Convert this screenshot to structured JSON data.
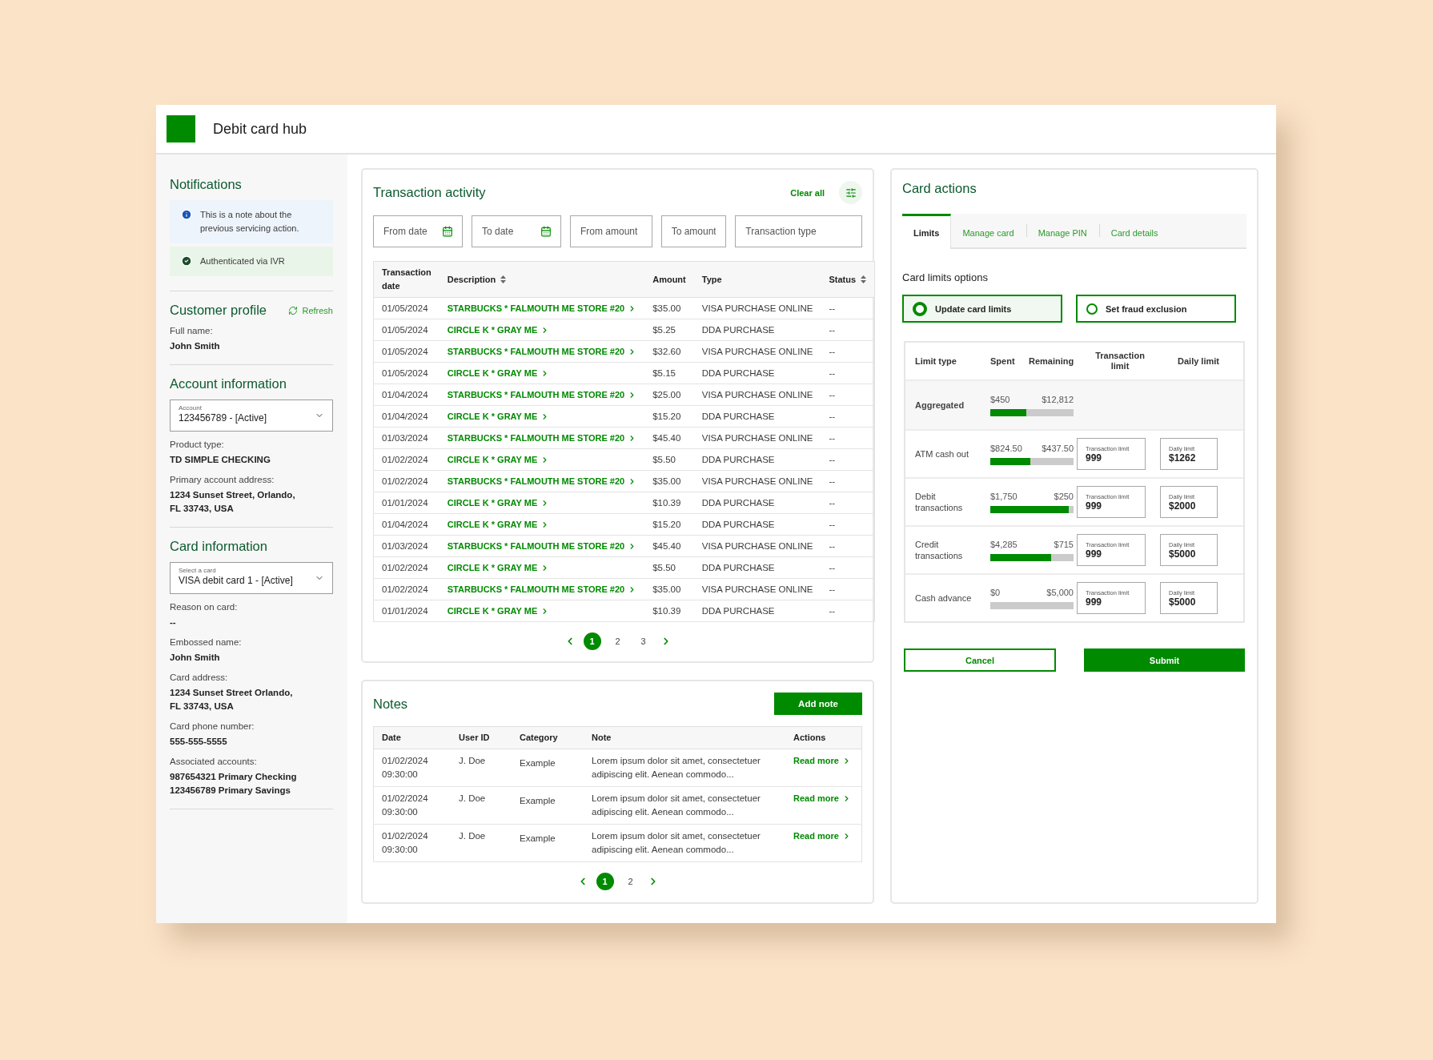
{
  "header": {
    "title": "Debit card hub"
  },
  "sidebar": [
    {
      "title": "Notifications",
      "notices": [
        {
          "kind": "info",
          "text": "This is a note about the previous servicing action."
        },
        {
          "kind": "success",
          "text": "Authenticated via IVR"
        }
      ]
    },
    {
      "title": "Customer profile",
      "action": "Refresh",
      "fields": [
        {
          "label": "Full name:",
          "lines": [
            "John Smith"
          ]
        }
      ]
    },
    {
      "title": "Account information",
      "select": {
        "label": "Account",
        "value": "123456789 - [Active]"
      },
      "fields": [
        {
          "label": "Product type:",
          "lines": [
            "TD SIMPLE CHECKING"
          ]
        },
        {
          "label": "Primary account address:",
          "lines": [
            "1234 Sunset Street, Orlando,",
            "FL 33743, USA"
          ]
        }
      ]
    },
    {
      "title": "Card information",
      "select": {
        "label": "Select a card",
        "value": "VISA debit card 1 - [Active]"
      },
      "fields": [
        {
          "label": "Reason on card:",
          "lines": [
            "--"
          ]
        },
        {
          "label": "Embossed name:",
          "lines": [
            "John Smith"
          ]
        },
        {
          "label": "Card address:",
          "lines": [
            "1234 Sunset Street Orlando,",
            "FL 33743, USA"
          ]
        },
        {
          "label": "Card phone number:",
          "lines": [
            "555-555-5555"
          ]
        },
        {
          "label": "Associated accounts:",
          "lines": [
            "987654321 Primary Checking",
            "123456789 Primary Savings"
          ]
        }
      ]
    }
  ],
  "transactions": {
    "title": "Transaction activity",
    "clear_all": "Clear all",
    "filters": [
      {
        "kind": "date",
        "placeholder": "From date"
      },
      {
        "kind": "date",
        "placeholder": "To date"
      },
      {
        "kind": "text",
        "placeholder": "From amount"
      },
      {
        "kind": "text",
        "placeholder": "To amount"
      },
      {
        "kind": "text",
        "placeholder": "Transaction type"
      }
    ],
    "columns": [
      {
        "label": "Transaction date",
        "sortable": false
      },
      {
        "label": "Description",
        "sortable": true
      },
      {
        "label": "Amount",
        "sortable": false
      },
      {
        "label": "Type",
        "sortable": false
      },
      {
        "label": "Status",
        "sortable": true
      }
    ],
    "rows": [
      [
        "01/05/2024",
        "STARBUCKS * FALMOUTH ME STORE #20",
        "$35.00",
        "VISA PURCHASE ONLINE",
        "--"
      ],
      [
        "01/05/2024",
        "CIRCLE K * GRAY ME",
        "$5.25",
        "DDA PURCHASE",
        "--"
      ],
      [
        "01/05/2024",
        "STARBUCKS * FALMOUTH ME STORE #20",
        "$32.60",
        "VISA PURCHASE ONLINE",
        "--"
      ],
      [
        "01/05/2024",
        "CIRCLE K * GRAY ME",
        "$5.15",
        "DDA PURCHASE",
        "--"
      ],
      [
        "01/04/2024",
        "STARBUCKS * FALMOUTH ME STORE #20",
        "$25.00",
        "VISA PURCHASE ONLINE",
        "--"
      ],
      [
        "01/04/2024",
        "CIRCLE K * GRAY ME",
        "$15.20",
        "DDA PURCHASE",
        "--"
      ],
      [
        "01/03/2024",
        "STARBUCKS * FALMOUTH ME STORE #20",
        "$45.40",
        "VISA PURCHASE ONLINE",
        "--"
      ],
      [
        "01/02/2024",
        "CIRCLE K * GRAY ME",
        "$5.50",
        "DDA PURCHASE",
        "--"
      ],
      [
        "01/02/2024",
        "STARBUCKS * FALMOUTH ME STORE #20",
        "$35.00",
        "VISA PURCHASE ONLINE",
        "--"
      ],
      [
        "01/01/2024",
        "CIRCLE K * GRAY ME",
        "$10.39",
        "DDA PURCHASE",
        "--"
      ],
      [
        "01/04/2024",
        "CIRCLE K * GRAY ME",
        "$15.20",
        "DDA PURCHASE",
        "--"
      ],
      [
        "01/03/2024",
        "STARBUCKS * FALMOUTH ME STORE #20",
        "$45.40",
        "VISA PURCHASE ONLINE",
        "--"
      ],
      [
        "01/02/2024",
        "CIRCLE K * GRAY ME",
        "$5.50",
        "DDA PURCHASE",
        "--"
      ],
      [
        "01/02/2024",
        "STARBUCKS * FALMOUTH ME STORE #20",
        "$35.00",
        "VISA PURCHASE ONLINE",
        "--"
      ],
      [
        "01/01/2024",
        "CIRCLE K * GRAY ME",
        "$10.39",
        "DDA PURCHASE",
        "--"
      ]
    ],
    "pagination": [
      {
        "label": "1",
        "selected": true
      },
      {
        "label": "2",
        "selected": false
      },
      {
        "label": "3",
        "selected": false
      }
    ]
  },
  "notes": {
    "title": "Notes",
    "add_note": "Add note",
    "columns": [
      "Date",
      "User ID",
      "Category",
      "Note",
      "Actions"
    ],
    "rows": [
      {
        "date": "01/02/2024 09:30:00",
        "user": "J. Doe",
        "category": "Example",
        "note": "Lorem ipsum dolor sit amet, consectetuer adipiscing elit. Aenean commodo...",
        "action": "Read more"
      },
      {
        "date": "01/02/2024 09:30:00",
        "user": "J. Doe",
        "category": "Example",
        "note": "Lorem ipsum dolor sit amet, consectetuer adipiscing elit. Aenean commodo...",
        "action": "Read more"
      },
      {
        "date": "01/02/2024 09:30:00",
        "user": "J. Doe",
        "category": "Example",
        "note": "Lorem ipsum dolor sit amet, consectetuer adipiscing elit. Aenean commodo...",
        "action": "Read more"
      }
    ],
    "pagination": [
      {
        "label": "1",
        "selected": true
      },
      {
        "label": "2",
        "selected": false
      }
    ]
  },
  "card_actions": {
    "title": "Card actions",
    "tabs": [
      {
        "label": "Limits",
        "selected": true
      },
      {
        "label": "Manage card",
        "selected": false
      },
      {
        "label": "Manage PIN",
        "selected": false
      },
      {
        "label": "Card details",
        "selected": false
      }
    ],
    "options_title": "Card limits options",
    "options": [
      {
        "label": "Update card limits",
        "selected": true
      },
      {
        "label": "Set fraud exclusion",
        "selected": false
      }
    ],
    "columns": [
      "Limit type",
      "Spent",
      "Remaining",
      "Transaction limit",
      "Daily limit"
    ],
    "rows": [
      {
        "kind": "aggregate",
        "type": "Aggregated",
        "spent": "$450",
        "remaining": "$12,812",
        "level": 0.43
      },
      {
        "kind": "editable",
        "type": "ATM cash out",
        "spent": "$824.50",
        "remaining": "$437.50",
        "level": 0.48,
        "transaction_limit": {
          "label": "Transaction limit",
          "value": "999"
        },
        "daily_limit": {
          "label": "Daily limit",
          "value": "$1262"
        }
      },
      {
        "kind": "editable",
        "type": "Debit transactions",
        "spent": "$1,750",
        "remaining": "$250",
        "level": 0.94,
        "transaction_limit": {
          "label": "Transaction limit",
          "value": "999"
        },
        "daily_limit": {
          "label": "Daily limit",
          "value": "$2000"
        }
      },
      {
        "kind": "editable",
        "type": "Credit transactions",
        "spent": "$4,285",
        "remaining": "$715",
        "level": 0.73,
        "transaction_limit": {
          "label": "Transaction limit",
          "value": "999"
        },
        "daily_limit": {
          "label": "Daily limit",
          "value": "$5000"
        }
      },
      {
        "kind": "editable",
        "type": "Cash advance",
        "spent": "$0",
        "remaining": "$5,000",
        "level": 0,
        "transaction_limit": {
          "label": "Transaction limit",
          "value": "999"
        },
        "daily_limit": {
          "label": "Daily limit",
          "value": "$5000"
        }
      }
    ],
    "buttons": [
      {
        "kind": "secondary",
        "label": "Cancel"
      },
      {
        "kind": "primary",
        "label": "Submit"
      }
    ]
  }
}
